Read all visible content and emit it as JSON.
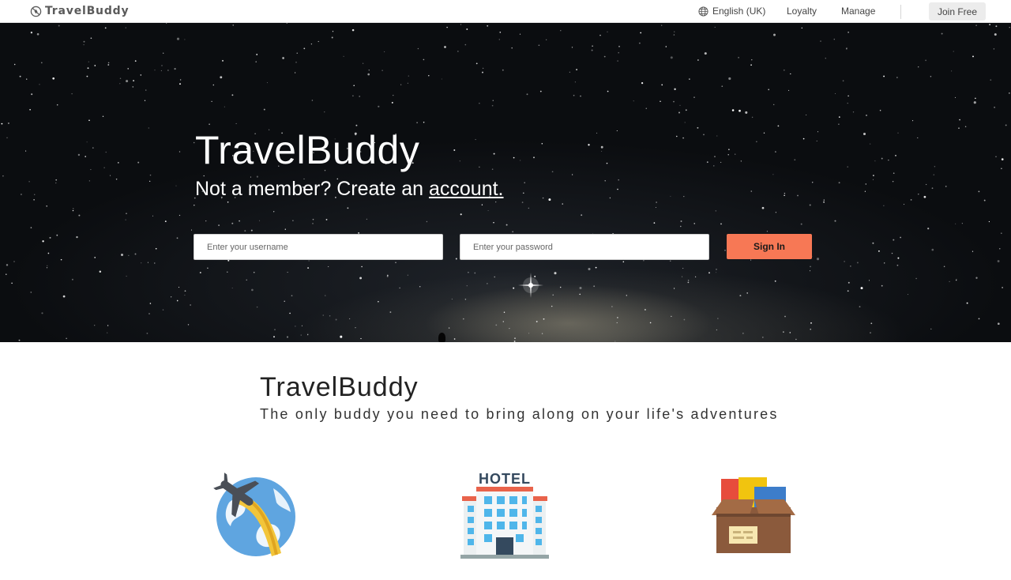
{
  "nav": {
    "brand": "TravelBuddy",
    "language": "English (UK)",
    "loyalty": "Loyalty",
    "manage": "Manage",
    "join": "Join Free"
  },
  "hero": {
    "title": "TravelBuddy",
    "subtitle_prefix": "Not a member? Create an ",
    "subtitle_link": "account.",
    "username_placeholder": "Enter your username",
    "password_placeholder": "Enter your password",
    "signin_label": "Sign In"
  },
  "about": {
    "title": "TravelBuddy",
    "tagline": "The only buddy you need to bring along on your life's adventures"
  },
  "features": {
    "hotel_sign": "HOTEL"
  },
  "icons": [
    "compass-logo-icon",
    "globe-icon",
    "plane-globe-icon",
    "hotel-icon",
    "package-box-icon"
  ],
  "colors": {
    "accent": "#f77855",
    "hero_bg": "#0a0c0f",
    "nav_text": "#444444"
  }
}
